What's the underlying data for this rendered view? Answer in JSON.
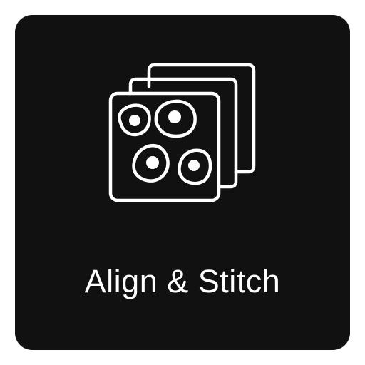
{
  "tile": {
    "label": "Align & Stitch",
    "icon": "stacked-cell-images-icon",
    "background_color": "#111112",
    "foreground_color": "#ffffff"
  }
}
